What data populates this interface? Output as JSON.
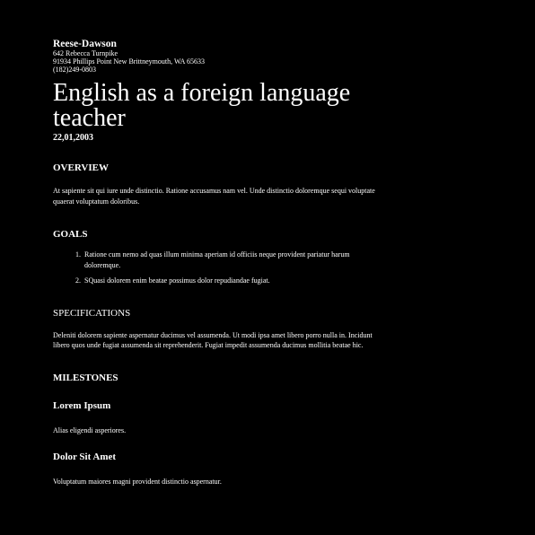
{
  "header": {
    "company": "Reese-Dawson",
    "address_line1": "642 Rebecca Turnpike",
    "address_line2": "91934 Phillips Point New Brittneymouth, WA 65633",
    "phone": "(182)249-0803"
  },
  "title_line1": "English as a foreign language",
  "title_line2": "teacher",
  "date": "22,01,2003",
  "overview": {
    "heading": "OVERVIEW",
    "text": "At sapiente sit qui iure unde distinctio. Ratione accusamus nam vel. Unde distinctio doloremque sequi voluptate quaerat voluptatum doloribus."
  },
  "goals": {
    "heading": "GOALS",
    "items": [
      "Ratione cum nemo ad quas illum minima aperiam id officiis neque provident pariatur harum doloremque.",
      "SQuasi dolorem enim beatae possimus dolor repudiandae fugiat."
    ]
  },
  "specifications": {
    "heading": "SPECIFICATIONS",
    "text": "Deleniti dolorem sapiente aspernatur ducimus vel assumenda. Ut modi ipsa amet libero porro nulla in. Incidunt libero quos unde fugiat assumenda sit reprehenderit. Fugiat impedit assumenda ducimus mollitia beatae hic."
  },
  "milestones": {
    "heading": "MILESTONES",
    "items": [
      {
        "title": "Lorem Ipsum",
        "text": "Alias eligendi asperiores."
      },
      {
        "title": "Dolor Sit Amet",
        "text": "Voluptatum maiores magni provident distinctio aspernatur."
      }
    ]
  }
}
